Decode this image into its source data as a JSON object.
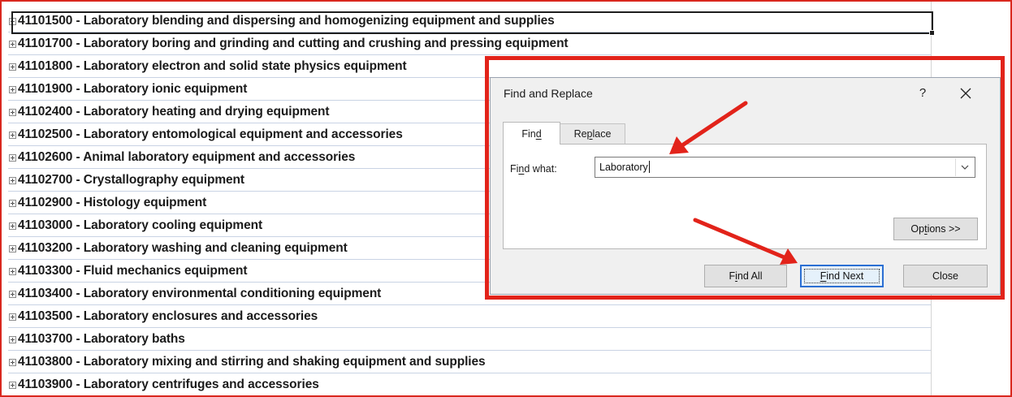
{
  "sheet": {
    "rows": [
      "41101500 - Laboratory blending and dispersing and homogenizing equipment and supplies",
      "41101700 - Laboratory boring and grinding and cutting and crushing and pressing equipment",
      "41101800 - Laboratory electron and solid state physics equipment",
      "41101900 - Laboratory ionic equipment",
      "41102400 - Laboratory heating and drying equipment",
      "41102500 - Laboratory entomological equipment and accessories",
      "41102600 - Animal laboratory equipment and accessories",
      "41102700 - Crystallography equipment",
      "41102900 - Histology equipment",
      "41103000 - Laboratory cooling equipment",
      "41103200 - Laboratory washing and cleaning equipment",
      "41103300 - Fluid mechanics equipment",
      "41103400 - Laboratory environmental conditioning equipment",
      "41103500 - Laboratory enclosures and accessories",
      "41103700 - Laboratory baths",
      "41103800 - Laboratory mixing and stirring and shaking equipment and supplies",
      "41103900 - Laboratory centrifuges and accessories"
    ],
    "expand_icon": "plus-box-icon"
  },
  "dialog": {
    "title": "Find and Replace",
    "help": "?",
    "close_icon": "close-x-icon",
    "tabs": {
      "find_pre": "Fin",
      "find_u": "d",
      "find_post": "",
      "replace_pre": "Re",
      "replace_u": "p",
      "replace_post": "lace"
    },
    "find_what": {
      "pre": "Fi",
      "u": "n",
      "post": "d what:",
      "value": "Laboratory"
    },
    "buttons": {
      "options_pre": "Op",
      "options_u": "t",
      "options_post": "ions >>",
      "find_all_pre": "F",
      "find_all_u": "i",
      "find_all_post": "nd All",
      "find_next_u": "F",
      "find_next_post": "ind Next",
      "close": "Close"
    }
  },
  "colors": {
    "annotation_red": "#e2231a",
    "row_divider": "#c9d3e4",
    "focus_blue": "#2b6fd3"
  }
}
